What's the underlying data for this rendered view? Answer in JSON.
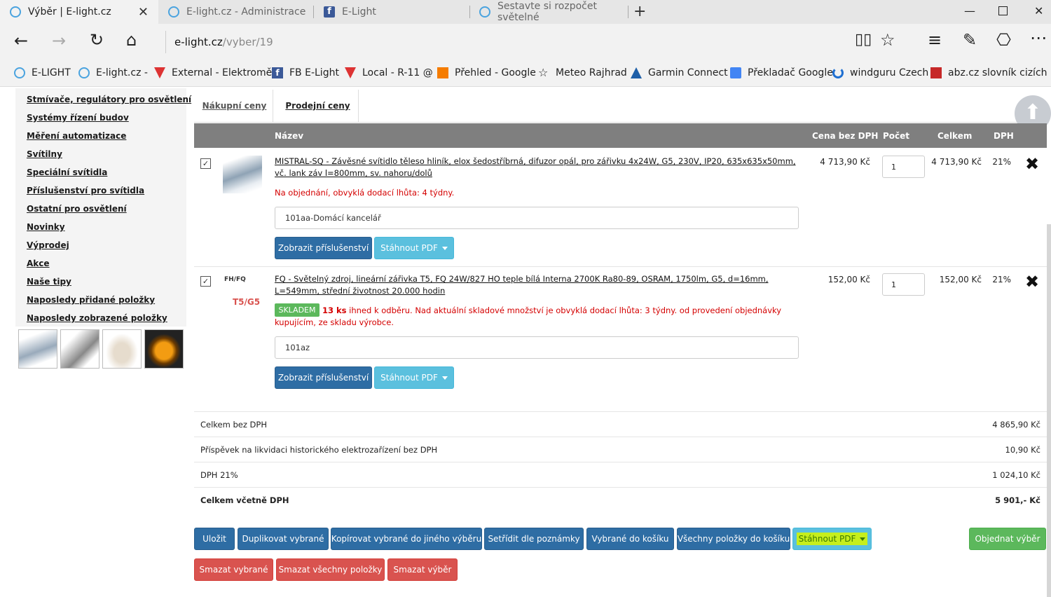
{
  "browser": {
    "tabs": [
      {
        "title": "Výběr | E-light.cz"
      },
      {
        "title": "E-light.cz - Administrace"
      },
      {
        "title": "E-Light"
      },
      {
        "title": "Sestavte si rozpočet světelné"
      }
    ],
    "new_tab": "+",
    "url_domain": "e-light.cz",
    "url_path": "/vyber/19",
    "favorites": [
      {
        "label": "E-LIGHT"
      },
      {
        "label": "E-light.cz -"
      },
      {
        "label": "External - Elektroměr"
      },
      {
        "label": "FB E-Light"
      },
      {
        "label": "Local - R-11 @"
      },
      {
        "label": "Přehled - Google"
      },
      {
        "label": "Meteo Rajhrad"
      },
      {
        "label": "Garmin Connect"
      },
      {
        "label": "Překladač Google"
      },
      {
        "label": "windguru Czech"
      },
      {
        "label": "abz.cz slovník cizích"
      }
    ]
  },
  "sidebar": {
    "links": [
      "Stmívače, regulátory pro osvětlení",
      "Systémy řízení budov",
      "Měření automatizace",
      "Svítilny",
      "Speciální svítidla",
      "Příslušenství pro svítidla",
      "Ostatní pro osvětlení",
      "Novinky",
      "Výprodej",
      "Akce",
      "Naše tipy",
      "Naposledy přidané položky",
      "Naposledy zobrazené položky"
    ]
  },
  "content": {
    "tabs": [
      "Nákupní ceny",
      "Prodejní ceny"
    ],
    "columns": {
      "name": "Název",
      "price": "Cena bez DPH",
      "qty": "Počet",
      "total": "Celkem",
      "vat": "DPH"
    },
    "items": [
      {
        "name": "MISTRAL-SQ - Závěsné svítidlo těleso hliník, elox šedostříbrná, difuzor opál, pro zářivku 4x24W, G5, 230V, IP20, 635x635x50mm, vč. lank záv l=800mm, sv. nahoru/dolů",
        "availability": "Na objednání, obvyklá dodací lhůta: 4 týdny.",
        "price": "4 713,90 Kč",
        "qty": "1",
        "total": "4 713,90 Kč",
        "vat": "21%",
        "note": "101aa-Domácí kancelář"
      },
      {
        "name": "FQ - Světelný zdroj, lineární zářivka T5, FQ 24W/827 HO teple bílá Interna 2700K Ra80-89, OSRAM, 1750lm, G5, d=16mm, L=549mm, střední životnost 20.000 hodin",
        "stock_badge": "SKLADEM",
        "stock_count": "13 ks",
        "stock_text": "ihned k odběru. Nad aktuální skladové množství je obvyklá dodací lhůta: 3 týdny. od provedení objednávky kupujícím, ze skladu výrobce.",
        "thumb_label_top": "FH/FQ",
        "thumb_label_bottom": "T5/G5",
        "price": "152,00 Kč",
        "qty": "1",
        "total": "152,00 Kč",
        "vat": "21%",
        "note": "101az"
      }
    ],
    "item_buttons": {
      "accessories": "Zobrazit příslušenství",
      "pdf": "Stáhnout PDF"
    },
    "summary": [
      {
        "label": "Celkem bez DPH",
        "value": "4 865,90 Kč"
      },
      {
        "label": "Příspěvek na likvidaci historického elektrozařízení bez DPH",
        "value": "10,90 Kč"
      },
      {
        "label": "DPH 21%",
        "value": "1 024,10 Kč"
      },
      {
        "label": "Celkem včetně DPH",
        "value": "5 901,- Kč"
      }
    ],
    "actions": {
      "save": "Uložit",
      "duplicate": "Duplikovat vybrané",
      "copy": "Kopírovat vybrané do jiného výběru",
      "sort": "Setřídit dle poznámky",
      "selected_to_cart": "Vybrané do košíku",
      "all_to_cart": "Všechny položky do košíku",
      "download_pdf": "Stáhnout PDF",
      "order": "Objednat výběr",
      "delete_selected": "Smazat vybrané",
      "delete_all": "Smazat všechny položky",
      "delete_selection": "Smazat výběr"
    }
  }
}
